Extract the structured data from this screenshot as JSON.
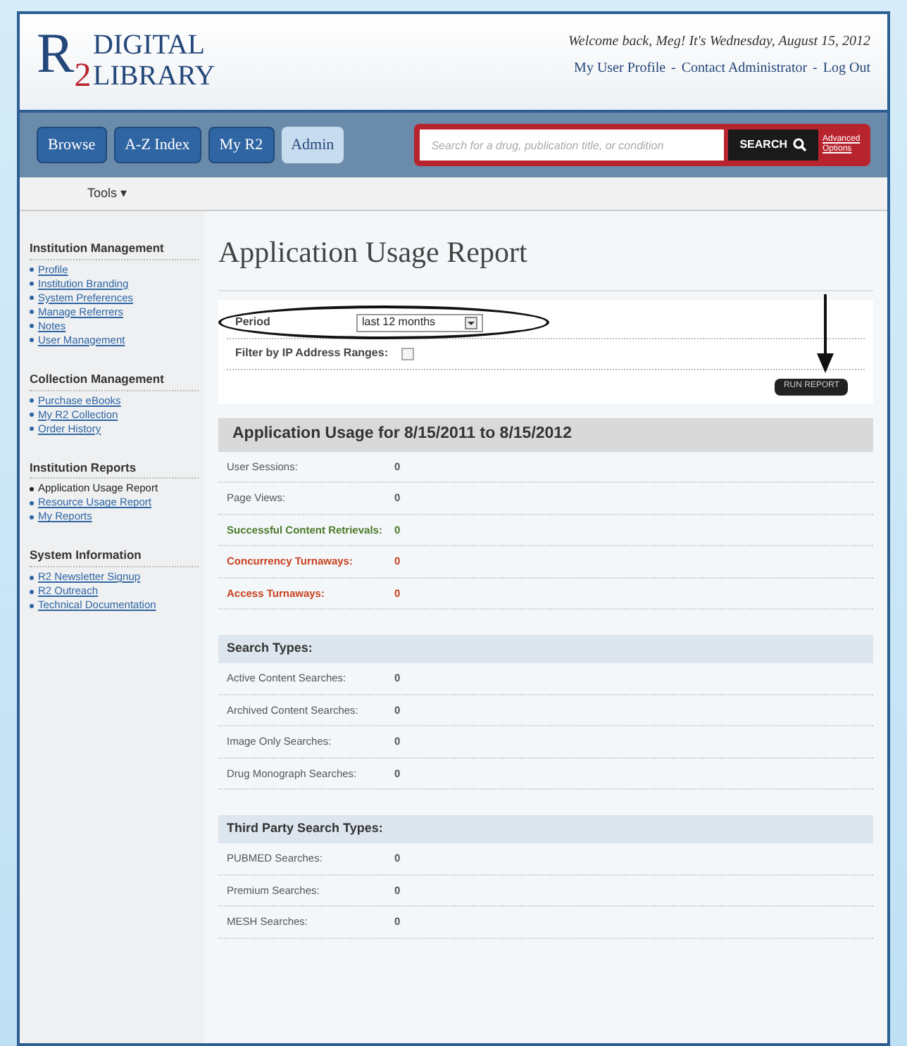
{
  "logo": {
    "letter": "R",
    "digit": "2",
    "line1": "DIGITAL",
    "line2": "LIBRARY"
  },
  "welcome": "Welcome back, Meg! It's Wednesday, August 15, 2012",
  "top_links": [
    "My User Profile",
    "Contact Administrator",
    "Log Out"
  ],
  "link_separator": "-",
  "nav_tabs": [
    {
      "label": "Browse",
      "selected": false
    },
    {
      "label": "A-Z Index",
      "selected": false
    },
    {
      "label": "My R2",
      "selected": false
    },
    {
      "label": "Admin",
      "selected": true
    }
  ],
  "search": {
    "placeholder": "Search for a drug, publication title, or condition",
    "button": "SEARCH",
    "advanced_link": "Advanced Options"
  },
  "tools_menu": "Tools ▾",
  "sidebar": [
    {
      "heading": "Institution Management",
      "items": [
        {
          "label": "Profile",
          "selected": false
        },
        {
          "label": "Institution Branding",
          "selected": false
        },
        {
          "label": "System Preferences",
          "selected": false
        },
        {
          "label": "Manage Referrers",
          "selected": false
        },
        {
          "label": "Notes",
          "selected": false
        },
        {
          "label": "User Management",
          "selected": false
        }
      ]
    },
    {
      "heading": "Collection Management",
      "items": [
        {
          "label": "Purchase eBooks",
          "selected": false
        },
        {
          "label": "My R2 Collection",
          "selected": false
        },
        {
          "label": "Order History",
          "selected": false
        }
      ]
    },
    {
      "heading": "Institution Reports",
      "items": [
        {
          "label": "Application Usage Report",
          "selected": true
        },
        {
          "label": "Resource Usage Report",
          "selected": false
        },
        {
          "label": "My Reports",
          "selected": false
        }
      ]
    },
    {
      "heading": "System Information",
      "items": [
        {
          "label": "R2 Newsletter Signup",
          "selected": false
        },
        {
          "label": "R2 Outreach",
          "selected": false
        },
        {
          "label": "Technical Documentation",
          "selected": false
        }
      ]
    }
  ],
  "page_title": "Application Usage Report",
  "form": {
    "period_label": "Period",
    "period_value": "last 12 months",
    "filter_label": "Filter by IP Address Ranges:",
    "filter_checked": false,
    "run_button": "RUN REPORT"
  },
  "sections": [
    {
      "title": "Application Usage for 8/15/2011 to 8/15/2012",
      "kind": "summary",
      "rows": [
        {
          "label": "User Sessions:",
          "value": "0",
          "kind": "normal"
        },
        {
          "label": "Page Views:",
          "value": "0",
          "kind": "normal"
        },
        {
          "label": "Successful Content Retrievals:",
          "value": "0",
          "kind": "success"
        },
        {
          "label": "Concurrency Turnaways:",
          "value": "0",
          "kind": "alert"
        },
        {
          "label": "Access Turnaways:",
          "value": "0",
          "kind": "alert"
        }
      ]
    },
    {
      "title": "Search Types:",
      "kind": "group",
      "rows": [
        {
          "label": "Active Content Searches:",
          "value": "0",
          "kind": "normal"
        },
        {
          "label": "Archived Content Searches:",
          "value": "0",
          "kind": "normal"
        },
        {
          "label": "Image Only Searches:",
          "value": "0",
          "kind": "normal"
        },
        {
          "label": "Drug Monograph Searches:",
          "value": "0",
          "kind": "normal"
        }
      ]
    },
    {
      "title": "Third Party Search Types:",
      "kind": "group",
      "rows": [
        {
          "label": "PUBMED Searches:",
          "value": "0",
          "kind": "normal"
        },
        {
          "label": "Premium Searches:",
          "value": "0",
          "kind": "normal"
        },
        {
          "label": "MESH Searches:",
          "value": "0",
          "kind": "normal"
        }
      ]
    }
  ]
}
